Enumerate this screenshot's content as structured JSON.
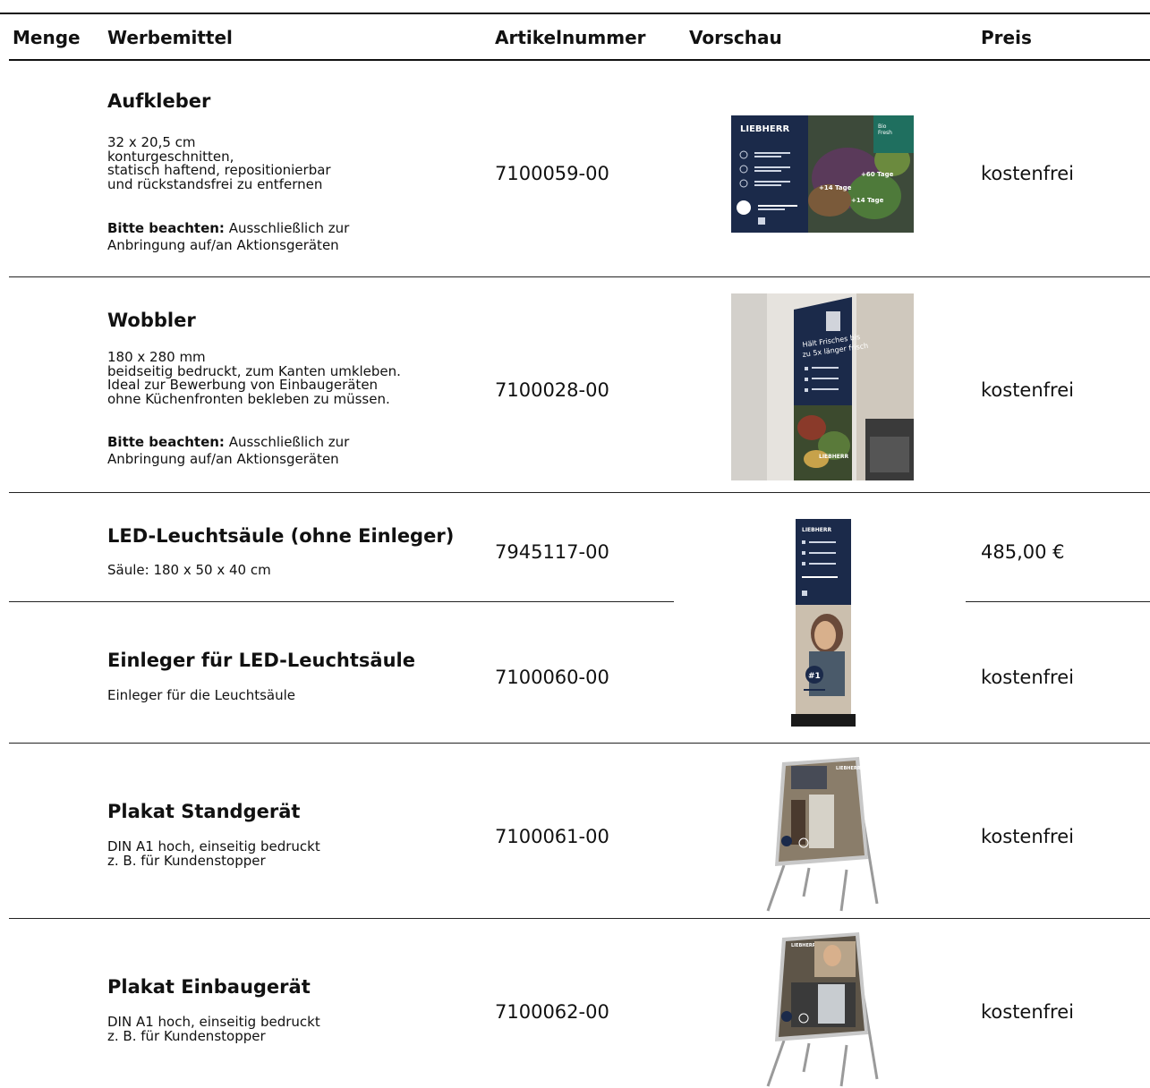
{
  "header": {
    "menge": "Menge",
    "werbemittel": "Werbemittel",
    "artikelnummer": "Artikelnummer",
    "vorschau": "Vorschau",
    "preis": "Preis"
  },
  "rows": [
    {
      "title": "Aufkleber",
      "desc": "32 x 20,5 cm\nkonturgeschnitten,\nstatisch haftend, repositionierbar\nund rückstandsfrei zu entfernen",
      "note_bold": "Bitte beachten:",
      "note_text": " Ausschließlich zur\nAnbringung auf/an Aktionsgeräten",
      "article": "7100059-00",
      "price": "kostenfrei",
      "preview": {
        "brand": "LIEBHERR",
        "badge": "Bio\nFresh",
        "tags": [
          "+14 Tage",
          "+60 Tage",
          "+14 Tage"
        ]
      }
    },
    {
      "title": "Wobbler",
      "desc": "180 x 280 mm\nbeidseitig bedruckt, zum Kanten umkleben.\nIdeal zur Bewerbung von Einbaugeräten\nohne Küchenfronten bekleben zu müssen.",
      "note_bold": "Bitte beachten:",
      "note_text": " Ausschließlich zur\nAnbringung auf/an Aktionsgeräten",
      "article": "7100028-00",
      "price": "kostenfrei",
      "preview": {
        "headline": "Hält Frisches bis\nzu 5x länger frisch",
        "brand": "LIEBHERR"
      }
    },
    {
      "title": "LED-Leuchtsäule (ohne Einleger)",
      "desc": "Säule: 180 x 50 x 40 cm",
      "article": "7945117-00",
      "price": "485,00 €",
      "preview": {
        "brand": "LIEBHERR",
        "badge": "#1"
      }
    },
    {
      "title": "Einleger für LED-Leuchtsäule",
      "desc": "Einleger für die Leuchtsäule",
      "article": "7100060-00",
      "price": "kostenfrei"
    },
    {
      "title": "Plakat Standgerät",
      "desc": "DIN A1 hoch, einseitig bedruckt\nz. B. für Kundenstopper",
      "article": "7100061-00",
      "price": "kostenfrei",
      "preview": {
        "brand": "LIEBHERR"
      }
    },
    {
      "title": "Plakat Einbaugerät",
      "desc": "DIN A1 hoch, einseitig bedruckt\nz. B. für Kundenstopper",
      "article": "7100062-00",
      "price": "kostenfrei",
      "preview": {
        "brand": "LIEBHERR"
      }
    }
  ],
  "colors": {
    "navy": "#1b2a4a",
    "teal": "#1f6f5f",
    "rule": "#111111"
  }
}
